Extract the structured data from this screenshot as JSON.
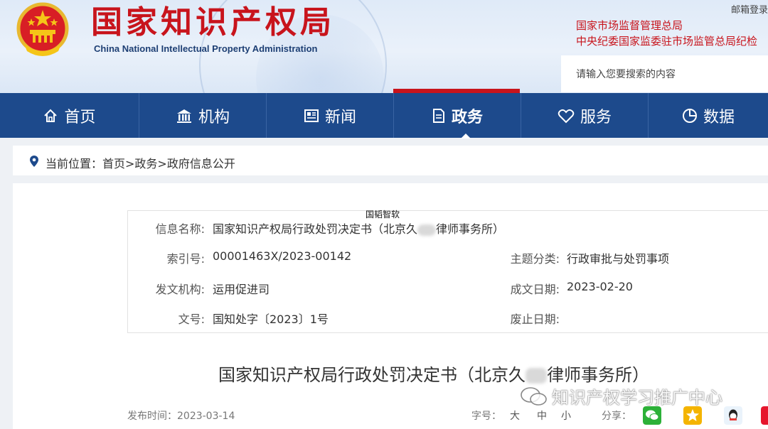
{
  "header": {
    "title": "国家知识产权局",
    "subtitle": "China National Intellectual Property Administration",
    "mail_login": "邮箱登录",
    "links": [
      "国家市场监督管理总局",
      "中央纪委国家监委驻市场监管总局纪检"
    ],
    "search_placeholder": "请输入您要搜索的内容"
  },
  "nav": {
    "items": [
      {
        "label": "首页",
        "icon": "home-icon"
      },
      {
        "label": "机构",
        "icon": "institution-icon"
      },
      {
        "label": "新闻",
        "icon": "news-icon"
      },
      {
        "label": "政务",
        "icon": "government-icon"
      },
      {
        "label": "服务",
        "icon": "service-icon"
      },
      {
        "label": "数据",
        "icon": "data-icon"
      }
    ],
    "active": "政务"
  },
  "breadcrumb": "当前位置：首页>政务>政府信息公开",
  "watermark_small": "国韬智软",
  "info": {
    "name_label": "信息名称:",
    "name_value_a": "国家知识产权局行政处罚决定书（北京久",
    "name_value_b": "律师事务所）",
    "index_label": "索引号:",
    "index_value": "00001463X/2023-00142",
    "topic_label": "主题分类:",
    "topic_value": "行政审批与处罚事项",
    "org_label": "发文机构:",
    "org_value": "运用促进司",
    "date_label": "成文日期:",
    "date_value": "2023-02-20",
    "doc_no_label": "文号:",
    "doc_no_value": "国知处字〔2023〕1号",
    "abolish_label": "废止日期:",
    "abolish_value": ""
  },
  "document": {
    "title_a": "国家知识产权局行政处罚决定书（北京久",
    "title_b": "律师事务所）",
    "publish_time": "发布时间：2023-03-14",
    "font_size_label": "字号：",
    "font_sizes": [
      "大",
      "中",
      "小"
    ],
    "share_label": "分享："
  },
  "watermark_large": "知识产权学习推广中心",
  "colors": {
    "brand_red": "#c8141c",
    "nav_blue": "#1d4a8c"
  }
}
